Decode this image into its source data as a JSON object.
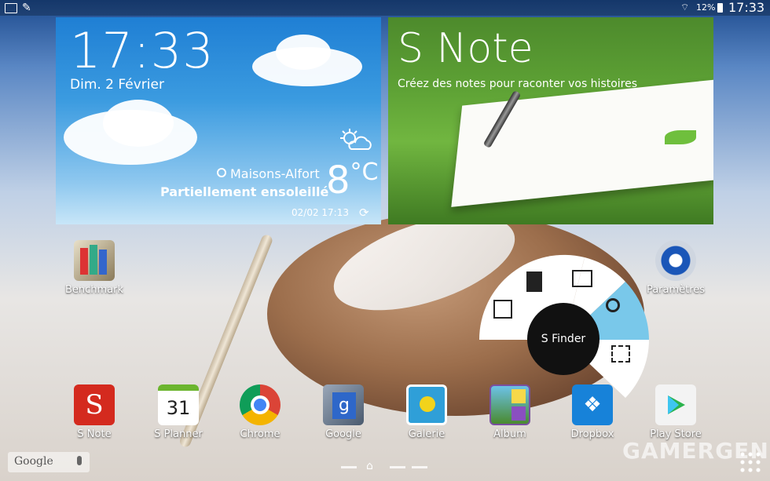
{
  "status_bar": {
    "battery": "12%",
    "time": "17:33"
  },
  "weather_widget": {
    "time": "17:33",
    "date": "Dim. 2 Février",
    "location": "Maisons-Alfort",
    "condition": "Partiellement ensoleillé",
    "temperature": "8",
    "unit": "°C",
    "updated": "02/02 17:13"
  },
  "snote_widget": {
    "title": "S Note",
    "subtitle": "Créez des notes pour raconter vos histoires"
  },
  "desktop_apps": {
    "benchmark": "Benchmark",
    "settings": "Paramètres"
  },
  "s_finder": {
    "label": "S Finder"
  },
  "dock": [
    {
      "label": "S Note"
    },
    {
      "label": "S Planner",
      "day": "31"
    },
    {
      "label": "Chrome"
    },
    {
      "label": "Google"
    },
    {
      "label": "Galerie"
    },
    {
      "label": "Album"
    },
    {
      "label": "Dropbox"
    },
    {
      "label": "Play Store"
    }
  ],
  "google_bar": {
    "text": "Google"
  },
  "watermark": "GAMERGEN",
  "colors": {
    "radial_accent": "#79c8ea",
    "finder_center": "#111111"
  }
}
